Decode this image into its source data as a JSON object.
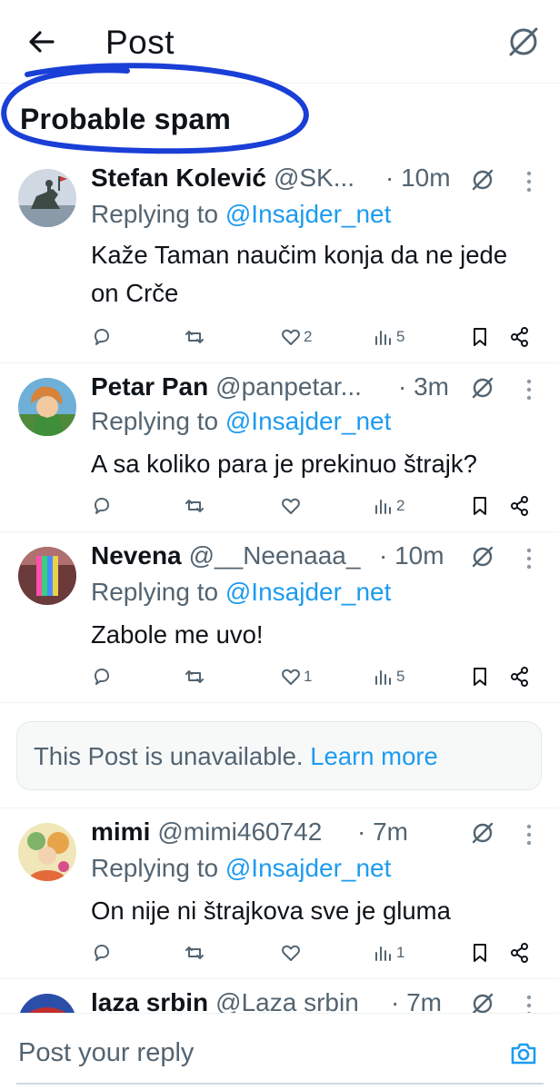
{
  "header": {
    "title": "Post",
    "back_icon": "arrow-left-icon",
    "grok_icon": "grok-slash-icon"
  },
  "section": {
    "label": "Probable spam",
    "annotation_color": "#1a3fd6"
  },
  "posts": [
    {
      "name": "Stefan Kolević",
      "handle": "@SK...",
      "time": "· 10m",
      "replying_prefix": "Replying to ",
      "replying_handle": "@Insajder_net",
      "text": "Kaže Taman naučim konja da ne jede on Crče",
      "likes": "2",
      "views": "5",
      "retweets": ""
    },
    {
      "name": "Petar Pan",
      "handle": "@panpetar...",
      "time": "· 3m",
      "replying_prefix": "Replying to ",
      "replying_handle": "@Insajder_net",
      "text": "A sa koliko para je prekinuo štrajk?",
      "likes": "",
      "views": "2",
      "retweets": ""
    },
    {
      "name": "Nevena",
      "handle": "@__Neenaaa_",
      "time": "· 10m",
      "replying_prefix": "Replying to ",
      "replying_handle": "@Insajder_net",
      "text": "Zabole me uvo!",
      "likes": "1",
      "views": "5",
      "retweets": ""
    },
    {
      "name": "mimi",
      "handle": "@mimi460742",
      "time": "· 7m",
      "replying_prefix": "Replying to ",
      "replying_handle": "@Insajder_net",
      "text": "On nije ni štrajkova sve je gluma",
      "likes": "",
      "views": "1",
      "retweets": ""
    },
    {
      "name": "laza srbin",
      "handle": "@Laza srbin",
      "time": "· 7m"
    }
  ],
  "unavailable": {
    "text": "This Post is unavailable. ",
    "link": "Learn more"
  },
  "composer": {
    "placeholder": "Post your reply",
    "camera_icon": "camera-icon"
  },
  "colors": {
    "accent": "#1d9bf0",
    "secondary_text": "#536471",
    "primary_text": "#0f1419"
  }
}
